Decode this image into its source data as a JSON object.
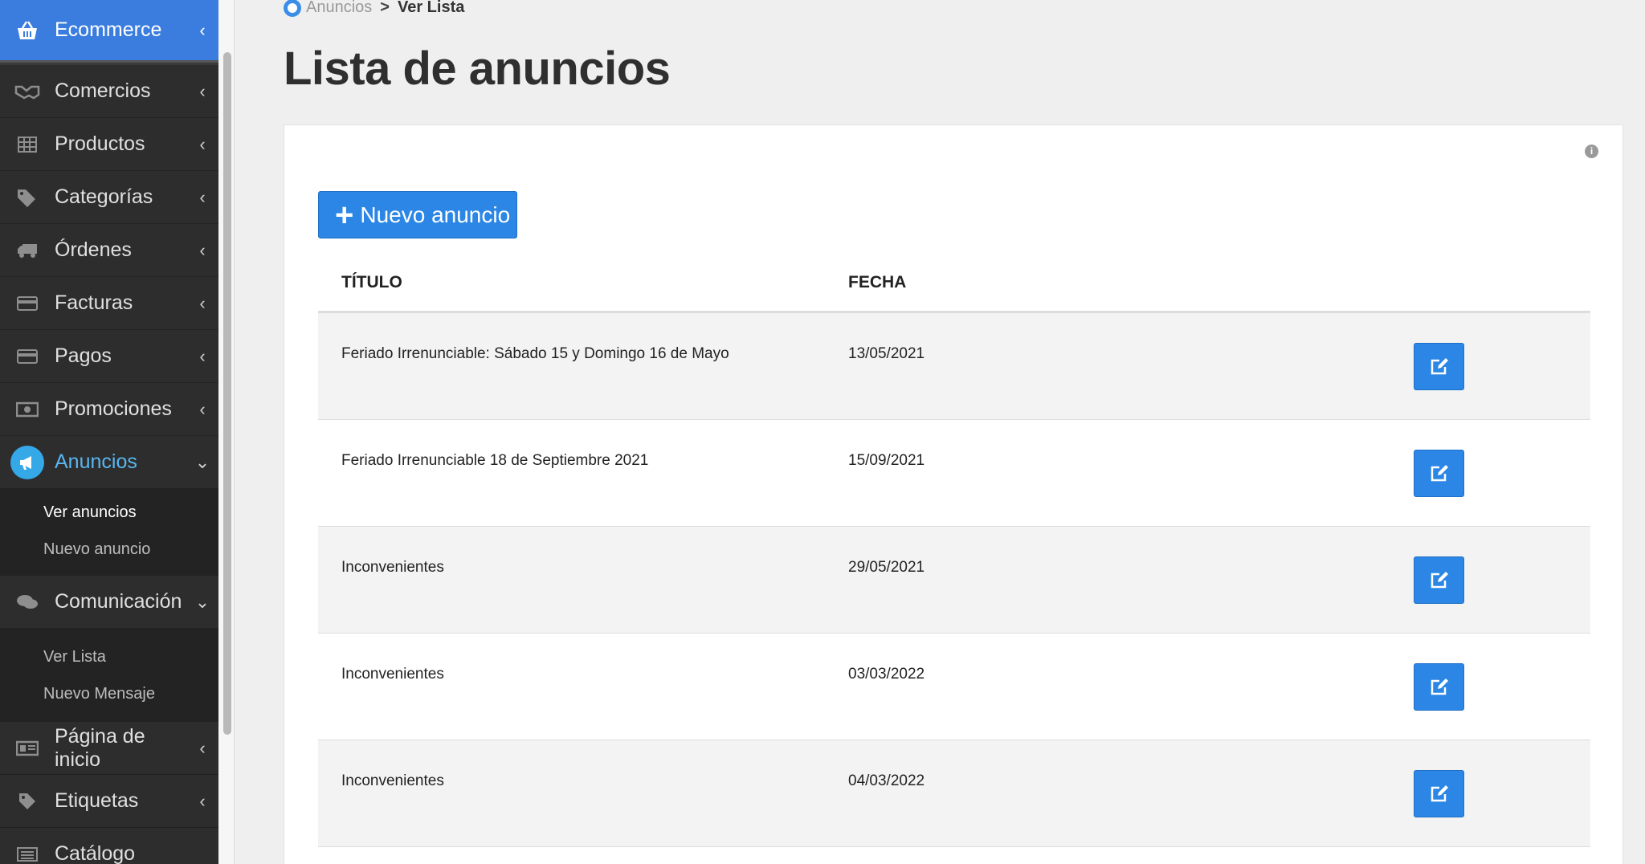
{
  "sidebar": {
    "header": {
      "label": "Ecommerce",
      "icon": "basket-icon"
    },
    "items": [
      {
        "label": "Comercios",
        "icon": "handshake-icon"
      },
      {
        "label": "Productos",
        "icon": "grid-icon"
      },
      {
        "label": "Categorías",
        "icon": "tags-icon"
      },
      {
        "label": "Órdenes",
        "icon": "truck-icon"
      },
      {
        "label": "Facturas",
        "icon": "credit-card-icon"
      },
      {
        "label": "Pagos",
        "icon": "credit-card-icon"
      },
      {
        "label": "Promociones",
        "icon": "money-icon"
      },
      {
        "label": "Anuncios",
        "icon": "megaphone-icon"
      },
      {
        "label": "Comunicación",
        "icon": "comments-icon"
      },
      {
        "label": "Página de inicio",
        "icon": "id-card-icon"
      },
      {
        "label": "Etiquetas",
        "icon": "tag-icon"
      },
      {
        "label": "Catálogo",
        "icon": "list-icon"
      }
    ],
    "anuncios_sub": [
      "Ver anuncios",
      "Nuevo anuncio"
    ],
    "comunicacion_sub": [
      "Ver Lista",
      "Nuevo Mensaje"
    ]
  },
  "breadcrumb": {
    "parent": "Anuncios",
    "separator": ">",
    "current": "Ver Lista"
  },
  "page_title": "Lista de anuncios",
  "new_button_label": "Nuevo anuncio",
  "table": {
    "headers": {
      "title": "TÍTULO",
      "date": "FECHA"
    },
    "rows": [
      {
        "title": "Feriado Irrenunciable: Sábado 15 y Domingo 16 de Mayo",
        "date": "13/05/2021"
      },
      {
        "title": "Feriado Irrenunciable 18 de Septiembre 2021",
        "date": "15/09/2021"
      },
      {
        "title": "Inconvenientes",
        "date": "29/05/2021"
      },
      {
        "title": "Inconvenientes",
        "date": "03/03/2022"
      },
      {
        "title": "Inconvenientes",
        "date": "04/03/2022"
      }
    ]
  },
  "colors": {
    "accent": "#2b86e5",
    "sidebar_bg": "#2d2d2d",
    "sidebar_header": "#3b7dde",
    "active_text": "#5ab6f0"
  }
}
